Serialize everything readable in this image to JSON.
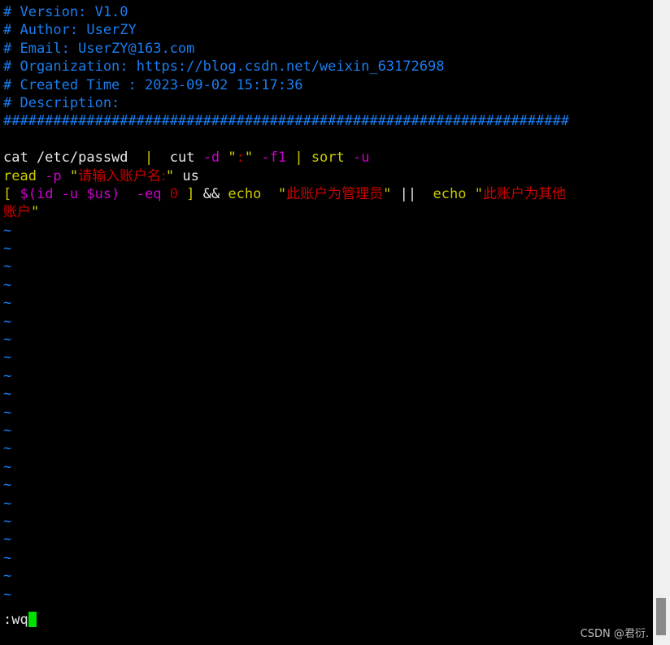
{
  "terminal": {
    "background": "#000000",
    "foreground": "#e8e8e8",
    "editor": "vim",
    "mode_line": ":wq",
    "cursor_color": "#00e000"
  },
  "colors": {
    "comment": "#1a7df0",
    "white": "#e8e8e8",
    "yellow": "#cdcd00",
    "magenta": "#cd00cd",
    "red": "#cd0000",
    "darkred": "#a80000",
    "tilde": "#1a7df0",
    "cursor": "#00e000",
    "scrollbar_track": "#f0f0f0",
    "scrollbar_thumb": "#8a8a8a",
    "watermark": "#bdbdbd"
  },
  "header_comments": [
    "# Version: V1.0",
    "# Author: UserZY",
    "# Email: UserZY@163.com",
    "# Organization: https://blog.csdn.net/weixin_63172698",
    "# Created Time : 2023-09-02 15:17:36",
    "# Description:",
    "####################################################################"
  ],
  "code_lines": {
    "line1": {
      "t1": "cat /etc/passwd  ",
      "t2": "|",
      "t3": "  cut ",
      "t4": "-d ",
      "t5": "\"",
      "t6": ":",
      "t7": "\"",
      "t8": " -f1",
      "t9": " | ",
      "t10": "sort ",
      "t11": "-u"
    },
    "line2": {
      "t1": "read ",
      "t2": "-p ",
      "t3": "\"",
      "t4": "请输入账户名:",
      "t5": "\"",
      "t6": " us"
    },
    "line3": {
      "t1": "[ ",
      "t2": "$(id -u $us)",
      "t3": "  -eq ",
      "t4": "0",
      "t5": " ]",
      "t6": " && ",
      "t7": "echo",
      "t8": "  ",
      "t9": "\"",
      "t10": "此账户为管理员",
      "t11": "\"",
      "t12": " || ",
      "t13": " echo ",
      "t14": "\"",
      "t15": "此账户为其他"
    },
    "line4": {
      "t1": "账户",
      "t2": "\""
    }
  },
  "tilde_char": "~",
  "tilde_count": 21,
  "command_line": {
    "text": ":wq"
  },
  "watermark": {
    "text": "CSDN @君衍."
  },
  "scrollbar": {
    "position_percent": 93
  }
}
